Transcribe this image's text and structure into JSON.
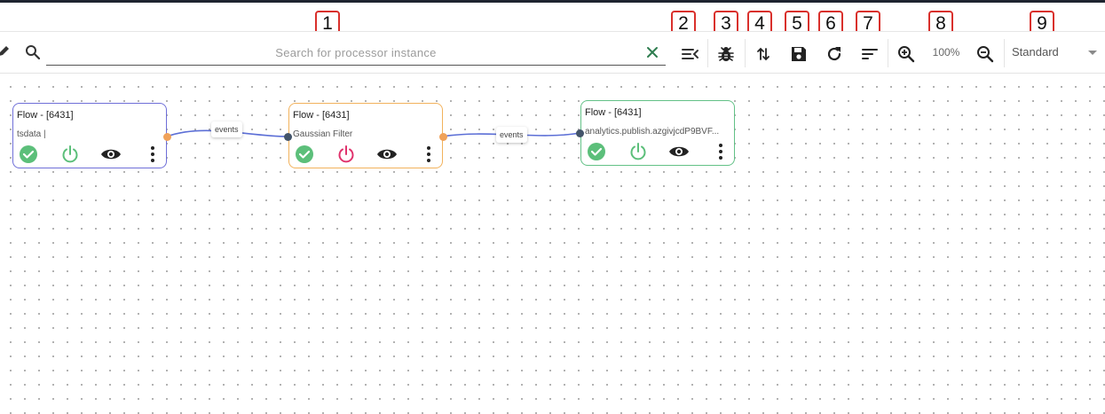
{
  "badges": [
    "1",
    "2",
    "3",
    "4",
    "5",
    "6",
    "7",
    "8",
    "9"
  ],
  "toolbar": {
    "search_placeholder": "Search for processor instance",
    "search_value": "",
    "zoom_level": "100%",
    "mode": "Standard",
    "icons": [
      "pencil-icon",
      "search-icon",
      "close-icon",
      "collapse-list-icon",
      "bug-icon",
      "sort-arrows-icon",
      "save-icon",
      "refresh-icon",
      "sort-icon",
      "zoom-in-icon",
      "zoom-out-icon",
      "chevron-down-icon"
    ]
  },
  "nodes": [
    {
      "title": "Flow - [6431]",
      "subtitle": "tsdata |",
      "border_color": "#6f6fd8",
      "power_color": "#5cbf7a"
    },
    {
      "title": "Flow - [6431]",
      "subtitle": "Gaussian Filter",
      "border_color": "#f2b25c",
      "power_color": "#e0336d"
    },
    {
      "title": "Flow - [6431]",
      "subtitle": "analytics.publish.azgivjcdP9BVF...",
      "border_color": "#63c187",
      "power_color": "#5cbf7a"
    }
  ],
  "edges": [
    {
      "label": "events"
    },
    {
      "label": "events"
    }
  ],
  "colors": {
    "status_ok": "#5cbf7a",
    "edge_line": "#5c6fd6",
    "out_port": "#f0a25a",
    "in_port": "#43546a",
    "badge_border": "#d9302c"
  }
}
